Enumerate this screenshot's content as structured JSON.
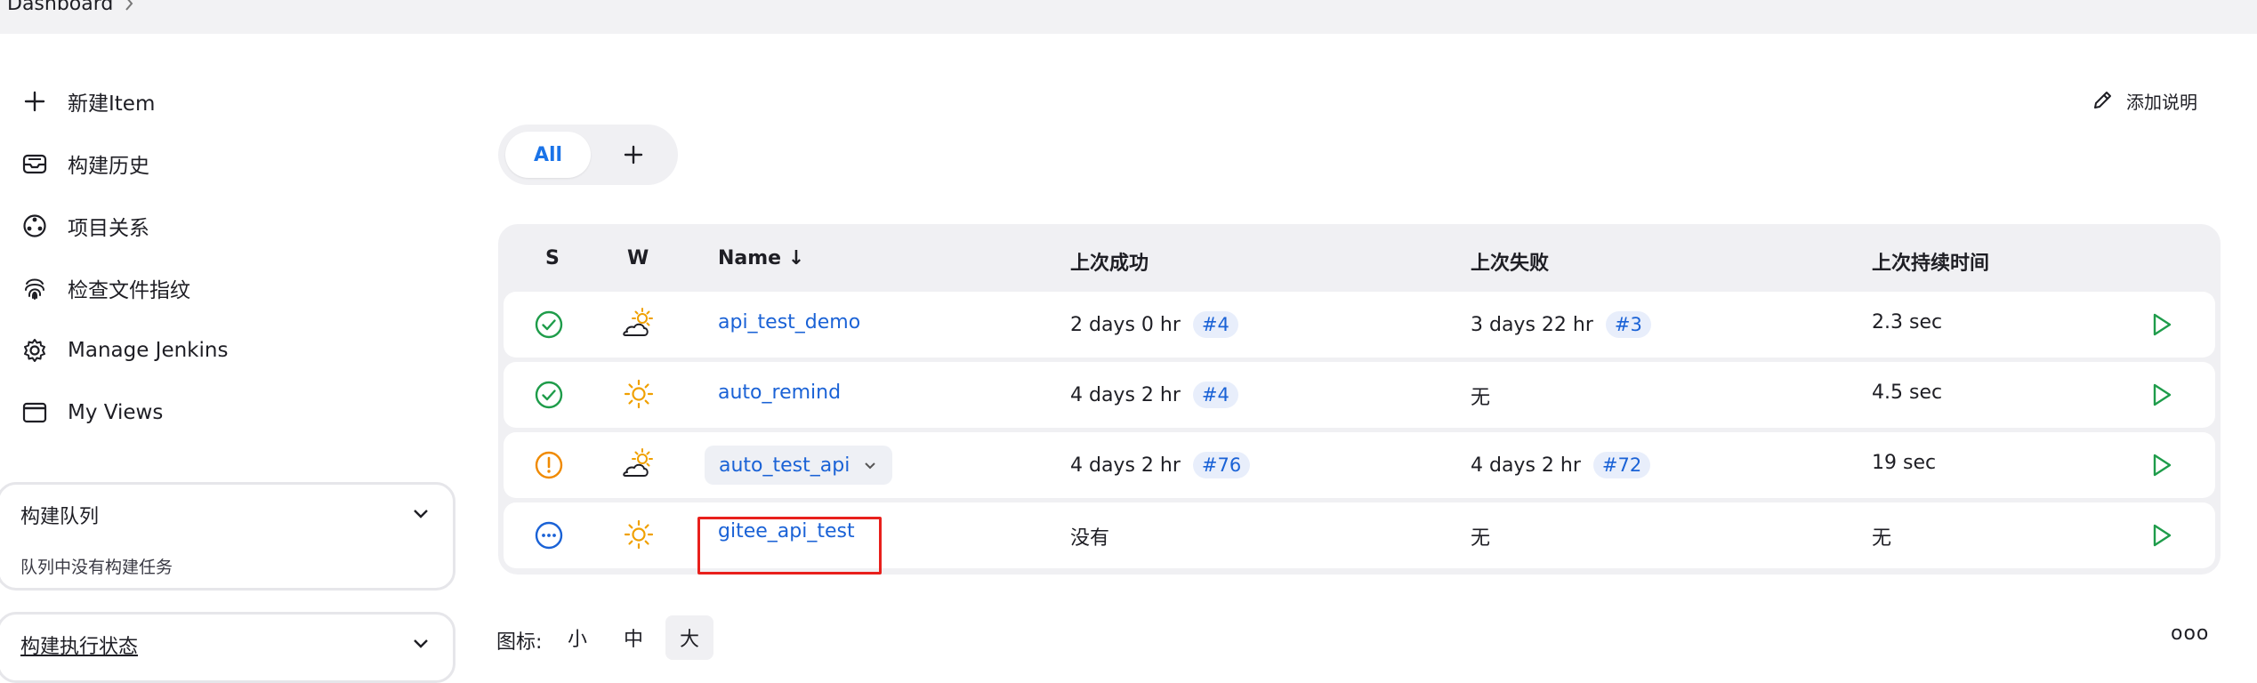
{
  "breadcrumb": {
    "root": "Dashboard"
  },
  "sidebar": {
    "items": [
      {
        "label": "新建Item",
        "icon": "plus-icon"
      },
      {
        "label": "构建历史",
        "icon": "inbox-icon"
      },
      {
        "label": "项目关系",
        "icon": "relations-icon"
      },
      {
        "label": "检查文件指纹",
        "icon": "fingerprint-icon"
      },
      {
        "label": "Manage Jenkins",
        "icon": "gear-icon"
      },
      {
        "label": "My Views",
        "icon": "window-icon"
      }
    ],
    "build_queue": {
      "title": "构建队列",
      "empty_text": "队列中没有构建任务"
    },
    "executor_status": {
      "title": "构建执行状态"
    }
  },
  "header": {
    "add_description": "添加说明"
  },
  "tabs": {
    "all": "All",
    "add": "+"
  },
  "table": {
    "columns": {
      "s": "S",
      "w": "W",
      "name": "Name ↓",
      "last_success": "上次成功",
      "last_failure": "上次失败",
      "last_duration": "上次持续时间"
    },
    "rows": [
      {
        "status": "success",
        "weather": "partly-cloudy",
        "name": "api_test_demo",
        "last_success": "2 days 0 hr",
        "last_success_build": "#4",
        "last_failure": "3 days 22 hr",
        "last_failure_build": "#3",
        "duration": "2.3 sec"
      },
      {
        "status": "success",
        "weather": "sunny",
        "name": "auto_remind",
        "last_success": "4 days 2 hr",
        "last_success_build": "#4",
        "last_failure": "无",
        "last_failure_build": "",
        "duration": "4.5 sec"
      },
      {
        "status": "unstable",
        "weather": "partly-cloudy",
        "name": "auto_test_api",
        "last_success": "4 days 2 hr",
        "last_success_build": "#76",
        "last_failure": "4 days 2 hr",
        "last_failure_build": "#72",
        "duration": "19 sec"
      },
      {
        "status": "not-built",
        "weather": "sunny",
        "name": "gitee_api_test",
        "last_success": "没有",
        "last_success_build": "",
        "last_failure": "无",
        "last_failure_build": "",
        "duration": "无"
      }
    ]
  },
  "footer": {
    "icon_label": "图标:",
    "sizes": [
      "小",
      "中",
      "大"
    ],
    "active_size": "大",
    "more": "ooo"
  },
  "colors": {
    "accent": "#1a62d6",
    "success": "#1e9c4a",
    "warning": "#f08a00",
    "highlight": "#e8201c"
  }
}
